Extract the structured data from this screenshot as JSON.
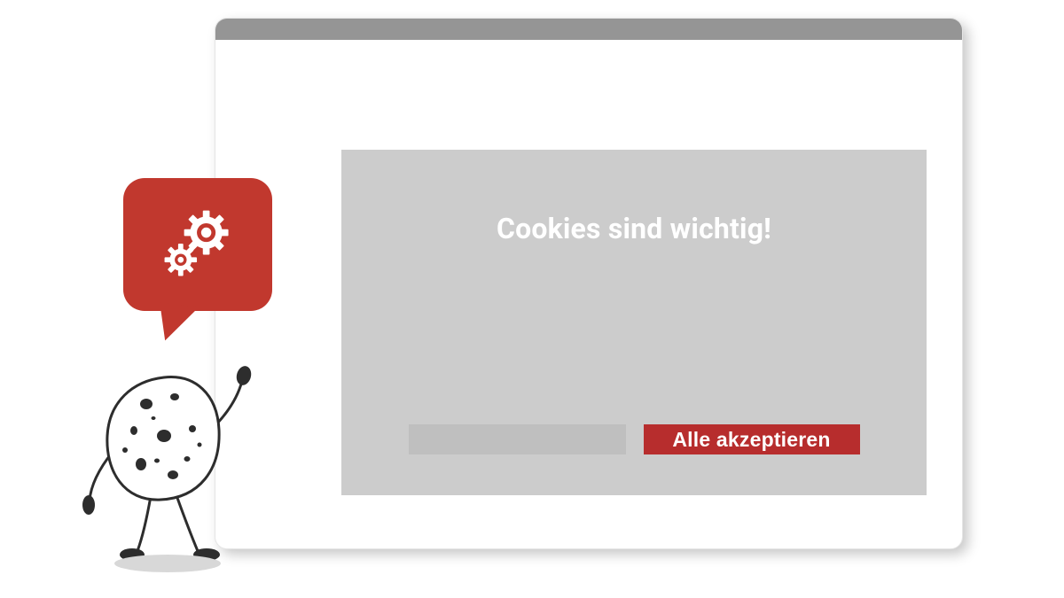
{
  "dialog": {
    "title": "Cookies sind wichtig!",
    "accept_label": "Alle akzeptieren"
  },
  "colors": {
    "accent": "#c1382e",
    "accept_button": "#b72d2d",
    "panel": "#cccccc",
    "chrome_bar": "#959595"
  },
  "icons": {
    "gears": "gears-icon"
  }
}
